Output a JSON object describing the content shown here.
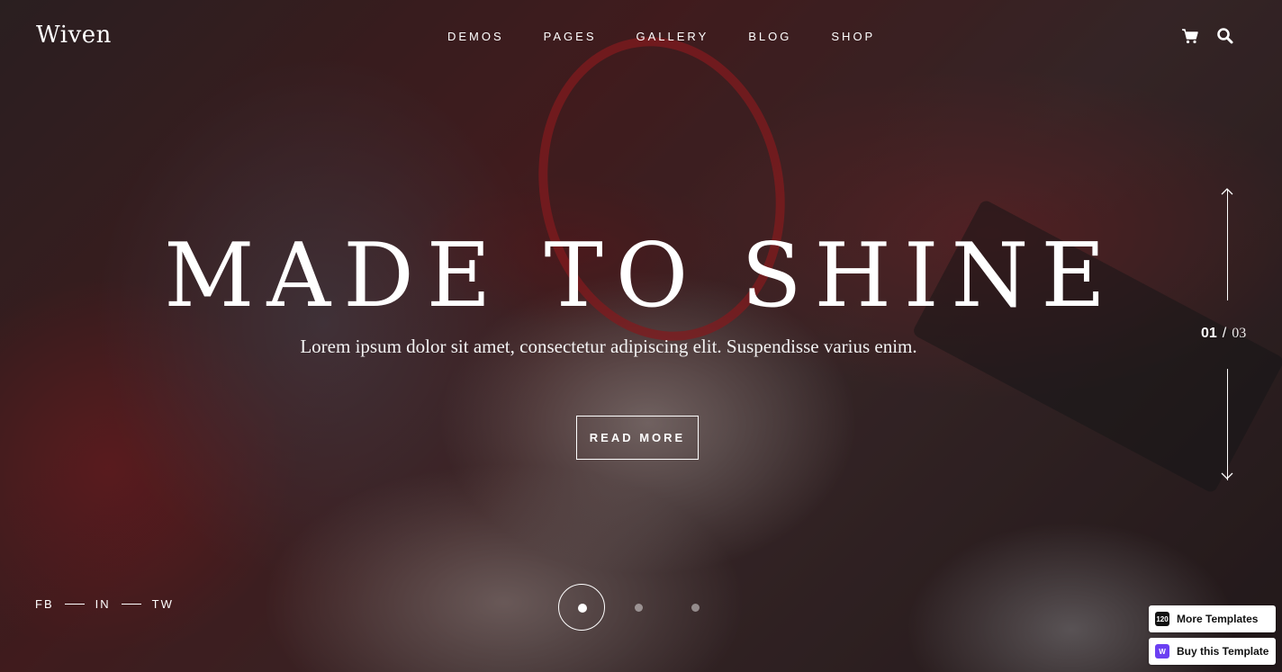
{
  "brand": {
    "logo": "Wiven"
  },
  "nav": {
    "items": [
      "DEMOS",
      "PAGES",
      "GALLERY",
      "BLOG",
      "SHOP"
    ]
  },
  "header_icons": {
    "cart": "cart-icon",
    "search": "search-icon"
  },
  "hero": {
    "title": "MADE TO SHINE",
    "subtitle": "Lorem ipsum dolor sit amet, consectetur adipiscing elit. Suspendisse varius enim.",
    "button": "READ MORE"
  },
  "slider": {
    "current": "01",
    "separator": "/",
    "total": "03",
    "dots": 3,
    "active_dot": 1
  },
  "social": {
    "items": [
      "FB",
      "IN",
      "TW"
    ]
  },
  "badges": {
    "more_templates": "More Templates",
    "more_templates_icon_text": "120",
    "buy_template": "Buy this Template",
    "buy_icon_text": "W",
    "buy_icon_color": "#6b3ff2"
  },
  "colors": {
    "text": "#ffffff",
    "accent_red": "#b9232b"
  }
}
